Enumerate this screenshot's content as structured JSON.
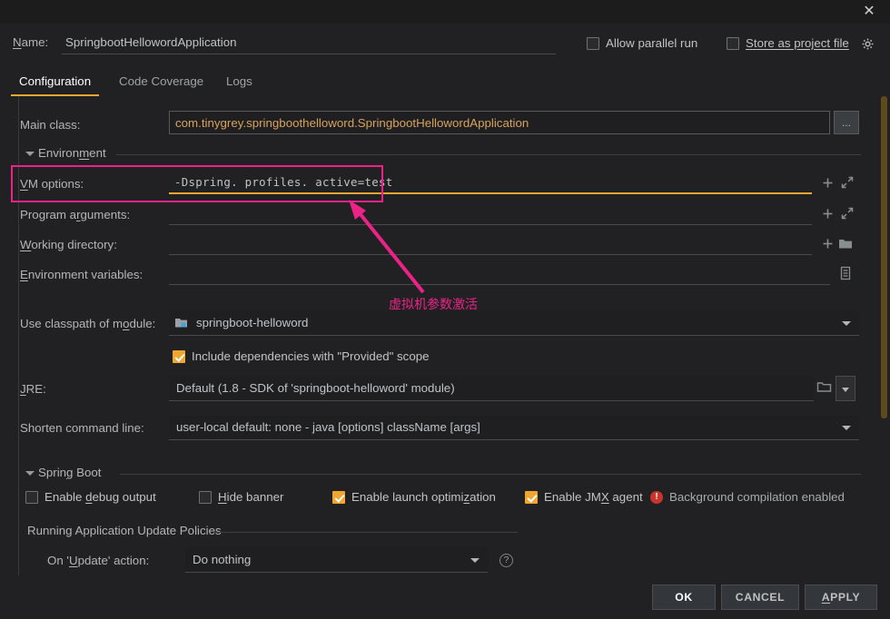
{
  "titlebar": {
    "close_label": "✕"
  },
  "name_row": {
    "label": "Name:",
    "value": "SpringbootHellowordApplication",
    "placeholder": "Name",
    "allow_parallel_run": "Allow parallel run",
    "store_as_project_file": "Store as project file",
    "gear_icon": "gear-icon"
  },
  "tabs": [
    {
      "label": "Configuration",
      "active": true
    },
    {
      "label": "Code Coverage",
      "active": false
    },
    {
      "label": "Logs",
      "active": false
    }
  ],
  "fields": {
    "main_class_label": "Main class:",
    "main_class_value": "com.tinygrey.springboothelloword.SpringbootHellowordApplication",
    "main_class_browse": "...",
    "environment_section": "Environment",
    "vm_options_label": "VM options:",
    "vm_options_value": "-Dspring. profiles. active=test",
    "program_arguments_label": "Program arguments:",
    "program_arguments_value": "",
    "working_directory_label": "Working directory:",
    "working_directory_value": "",
    "environment_variables_label": "Environment variables:",
    "environment_variables_value": "",
    "use_classpath_label": "Use classpath of module:",
    "use_classpath_value": "springboot-helloword",
    "include_provided_scope": "Include dependencies with \"Provided\" scope",
    "jre_label": "JRE:",
    "jre_value": "Default (1.8 - SDK of 'springboot-helloword' module)",
    "shorten_cmd_label": "Shorten command line:",
    "shorten_cmd_value": "user-local default: none - java [options] className [args]"
  },
  "spring_boot": {
    "section_title": "Spring Boot",
    "enable_debug_output": "Enable debug output",
    "hide_banner": "Hide banner",
    "enable_launch_optimization": "Enable launch optimization",
    "enable_jmx_agent": "Enable JMX agent",
    "background_compilation": "Background compilation enabled",
    "warn_glyph": "!",
    "update_policies_title": "Running Application Update Policies",
    "on_update_label": "On 'Update' action:",
    "on_update_value": "Do nothing",
    "help_glyph": "?"
  },
  "row_icons": {
    "add": "+",
    "expand": "expand-icon",
    "folder": "folder-icon",
    "list": "list-icon"
  },
  "footer": {
    "ok": "OK",
    "cancel": "CANCEL",
    "apply": "APPLY"
  },
  "annotation": {
    "text": "虚拟机参数激活",
    "color": "#ec2387"
  },
  "colors": {
    "accent": "#f0a732",
    "background": "#212123",
    "annotation": "#ec2387",
    "warning": "#c9342e"
  }
}
